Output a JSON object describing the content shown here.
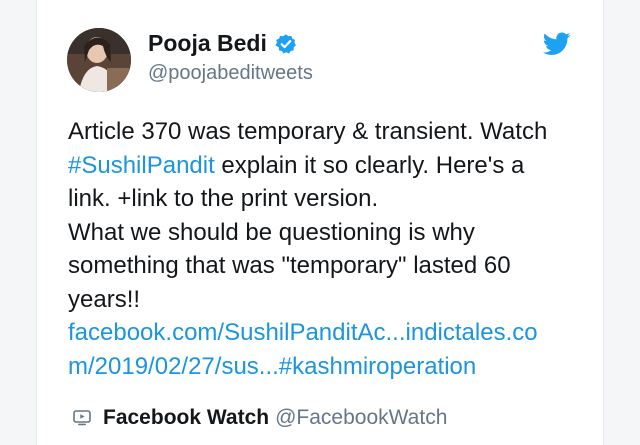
{
  "author": {
    "name": "Pooja Bedi",
    "handle": "@poojabeditweets"
  },
  "tweet": {
    "line1": "Article 370 was temporary & transient. Watch",
    "hashtag": "#SushilPandit",
    "line2_rest": " explain it so clearly. Here's a",
    "line3": "link.  +link to the print version.",
    "line4": "What we should be questioning is why",
    "line5": "something that was \"temporary\" lasted 60",
    "line6": "years!!",
    "link1": "facebook.com/SushilPanditAc...indictales.co",
    "link2": "m/2019/02/27/sus...#kashmiroperation"
  },
  "card": {
    "name": "Facebook Watch",
    "handle": "@FacebookWatch"
  },
  "colors": {
    "link": "#1b95e0",
    "twitter_blue": "#1da1f2"
  },
  "icons": [
    "verified-badge-icon",
    "twitter-bird-icon",
    "watch-icon"
  ]
}
